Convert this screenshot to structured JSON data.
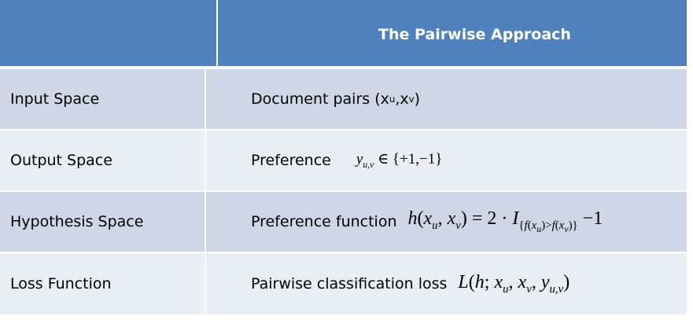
{
  "header": {
    "title": "The Pairwise Approach"
  },
  "rows": [
    {
      "label": "Input Space",
      "text": "Document pairs (x",
      "sub1": "u",
      "mid": ",x",
      "sub2": "v",
      "end": ")"
    },
    {
      "label": "Output Space",
      "text": "Preference"
    },
    {
      "label": "Hypothesis Space",
      "text": "Preference function"
    },
    {
      "label": "Loss Function",
      "text": "Pairwise classification loss"
    }
  ],
  "colors": {
    "header_bg": "#4f81bd",
    "row_odd": "#cfd7e6",
    "row_even": "#e9edf4",
    "header_text": "#ffffff"
  }
}
